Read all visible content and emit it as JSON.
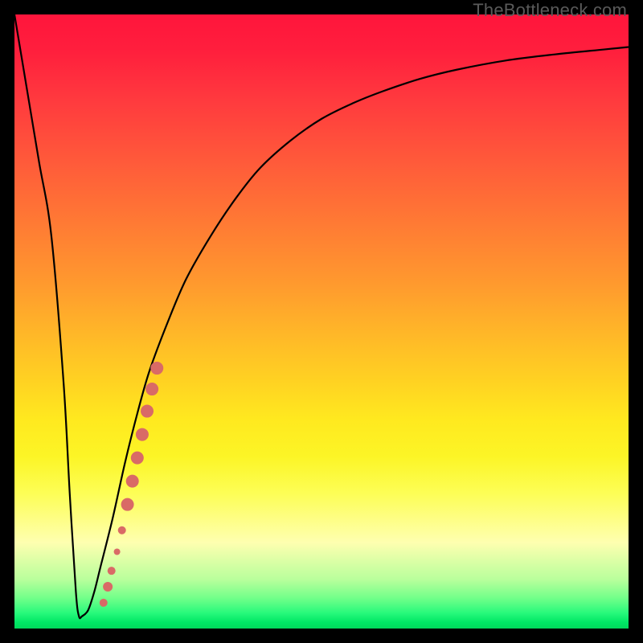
{
  "watermark": "TheBottleneck.com",
  "colors": {
    "curve": "#000000",
    "dots": "#d96a66",
    "frame": "#000000"
  },
  "chart_data": {
    "type": "line",
    "title": "",
    "xlabel": "",
    "ylabel": "",
    "xlim": [
      0,
      100
    ],
    "ylim": [
      0,
      100
    ],
    "series": [
      {
        "name": "bottleneck-curve",
        "x": [
          0,
          2,
          4,
          6,
          8,
          9,
          10,
          10.5,
          11,
          12,
          13,
          14,
          16,
          18,
          20,
          22,
          25,
          28,
          32,
          36,
          40,
          45,
          50,
          55,
          60,
          66,
          72,
          80,
          88,
          96,
          100
        ],
        "y": [
          100,
          88,
          76,
          64,
          40,
          22,
          6,
          2,
          2,
          3,
          6,
          10,
          18,
          27,
          35,
          42,
          50,
          57,
          64,
          70,
          75,
          79.5,
          83,
          85.5,
          87.5,
          89.5,
          91,
          92.5,
          93.5,
          94.3,
          94.7
        ]
      }
    ],
    "dot_cluster": {
      "name": "highlighted-points",
      "points": [
        {
          "x": 14.5,
          "y": 4.2,
          "r": 5
        },
        {
          "x": 15.2,
          "y": 6.8,
          "r": 6
        },
        {
          "x": 15.8,
          "y": 9.4,
          "r": 5
        },
        {
          "x": 16.7,
          "y": 12.5,
          "r": 4
        },
        {
          "x": 17.5,
          "y": 16.0,
          "r": 5
        },
        {
          "x": 18.4,
          "y": 20.2,
          "r": 8
        },
        {
          "x": 19.2,
          "y": 24.0,
          "r": 8
        },
        {
          "x": 20.0,
          "y": 27.8,
          "r": 8
        },
        {
          "x": 20.8,
          "y": 31.6,
          "r": 8
        },
        {
          "x": 21.6,
          "y": 35.4,
          "r": 8
        },
        {
          "x": 22.4,
          "y": 39.0,
          "r": 8
        },
        {
          "x": 23.2,
          "y": 42.4,
          "r": 8
        }
      ]
    }
  }
}
